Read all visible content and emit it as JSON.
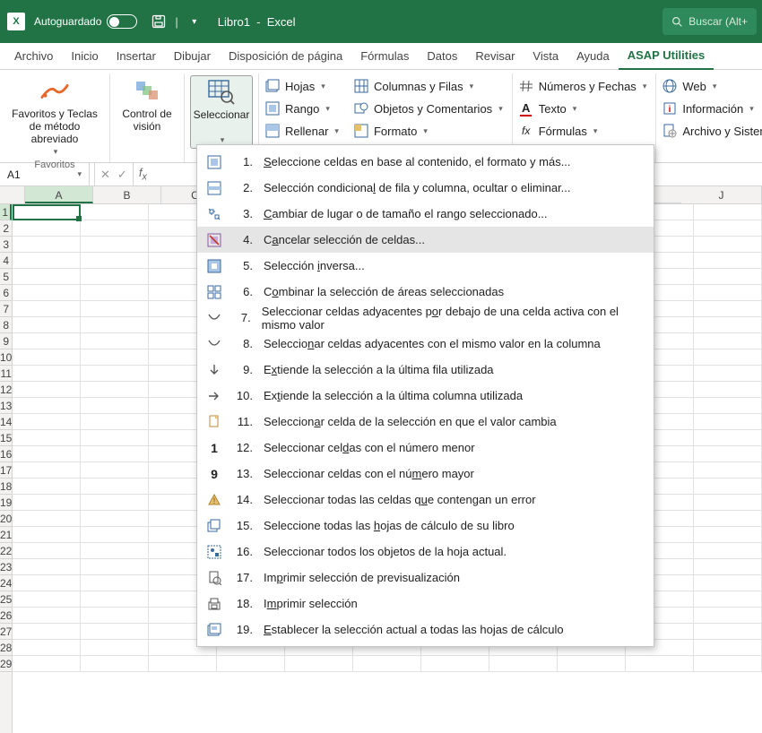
{
  "title_bar": {
    "autosave_label": "Autoguardado",
    "save_icon": "save",
    "doc_name": "Libro1",
    "app_name": "Excel",
    "search_placeholder": "Buscar (Alt+"
  },
  "ribbon_tabs": [
    "Archivo",
    "Inicio",
    "Insertar",
    "Dibujar",
    "Disposición de página",
    "Fórmulas",
    "Datos",
    "Revisar",
    "Vista",
    "Ayuda",
    "ASAP Utilities"
  ],
  "active_tab": "ASAP Utilities",
  "ribbon": {
    "group1": {
      "favorites_label": "Favoritos y Teclas de método abreviado",
      "group_label": "Favoritos"
    },
    "vision_label": "Control de visión",
    "select_label": "Seleccionar",
    "col_a": {
      "hojas": "Hojas",
      "rango": "Rango",
      "rellenar": "Rellenar"
    },
    "col_b": {
      "colfilas": "Columnas y Filas",
      "objetos": "Objetos y Comentarios",
      "formato": "Formato"
    },
    "col_c": {
      "numfechas": "Números y Fechas",
      "texto": "Texto",
      "formulas": "Fórmulas"
    },
    "col_d": {
      "web": "Web",
      "info": "Información",
      "archivo": "Archivo y Sistema"
    }
  },
  "formula_bar": {
    "name_box": "A1"
  },
  "grid": {
    "columns": [
      "A",
      "B",
      "C",
      "J"
    ],
    "rows": [
      "1",
      "2",
      "3",
      "4",
      "5",
      "6",
      "7",
      "8",
      "9",
      "10",
      "11",
      "12",
      "13",
      "14",
      "15",
      "16",
      "17",
      "18",
      "19",
      "20",
      "21",
      "22",
      "23",
      "24",
      "25",
      "26",
      "27",
      "28",
      "29"
    ]
  },
  "menu": [
    {
      "n": "1.",
      "label": "Seleccione celdas en base al contenido, el formato y más...",
      "ukey": "S",
      "upos": 0
    },
    {
      "n": "2.",
      "label": "Selección condicional de fila y columna, ocultar o eliminar...",
      "ukey": "f",
      "upos": 20
    },
    {
      "n": "3.",
      "label": "Cambiar de lugar o de tamaño el rango seleccionado...",
      "ukey": "C",
      "upos": 0
    },
    {
      "n": "4.",
      "label": "Cancelar selección de celdas...",
      "ukey": "a",
      "upos": 1,
      "hl": true
    },
    {
      "n": "5.",
      "label": "Selección inversa...",
      "ukey": "i",
      "upos": 10
    },
    {
      "n": "6.",
      "label": "Combinar la selección de áreas seleccionadas",
      "ukey": "o",
      "upos": 1
    },
    {
      "n": "7.",
      "label": "Seleccionar celdas adyacentes por debajo de una celda activa con el mismo valor",
      "ukey": "d",
      "upos": 31
    },
    {
      "n": "8.",
      "label": "Seleccionar celdas adyacentes con el mismo valor en la columna",
      "ukey": "n",
      "upos": 8
    },
    {
      "n": "9.",
      "label": "Extiende la selección a la última fila utilizada",
      "ukey": "x",
      "upos": 1
    },
    {
      "n": "10.",
      "label": "Extiende la selección a la última columna utilizada",
      "ukey": "t",
      "upos": 2
    },
    {
      "n": "11.",
      "label": "Seleccionar celda de la selección en que el valor cambia",
      "ukey": "r",
      "upos": 9
    },
    {
      "n": "12.",
      "label": "Seleccionar celdas con el número menor",
      "ukey": "d",
      "upos": 15
    },
    {
      "n": "13.",
      "label": "Seleccionar celdas con el número mayor",
      "ukey": "ú",
      "upos": 28
    },
    {
      "n": "14.",
      "label": "Seleccionar todas las celdas que contengan un error",
      "ukey": "q",
      "upos": 30
    },
    {
      "n": "15.",
      "label": "Seleccione todas las hojas de cálculo de su libro",
      "ukey": "h",
      "upos": 21
    },
    {
      "n": "16.",
      "label": "Seleccionar todos los objetos de la hoja actual.",
      "ukey": "b",
      "upos": 24
    },
    {
      "n": "17.",
      "label": "Imprimir selección de previsualización",
      "ukey": "p",
      "upos": 2
    },
    {
      "n": "18.",
      "label": "Imprimir selección",
      "ukey": "m",
      "upos": 1
    },
    {
      "n": "19.",
      "label": "Establecer la selección actual a todas las hojas de cálculo",
      "ukey": "E",
      "upos": 0
    }
  ]
}
